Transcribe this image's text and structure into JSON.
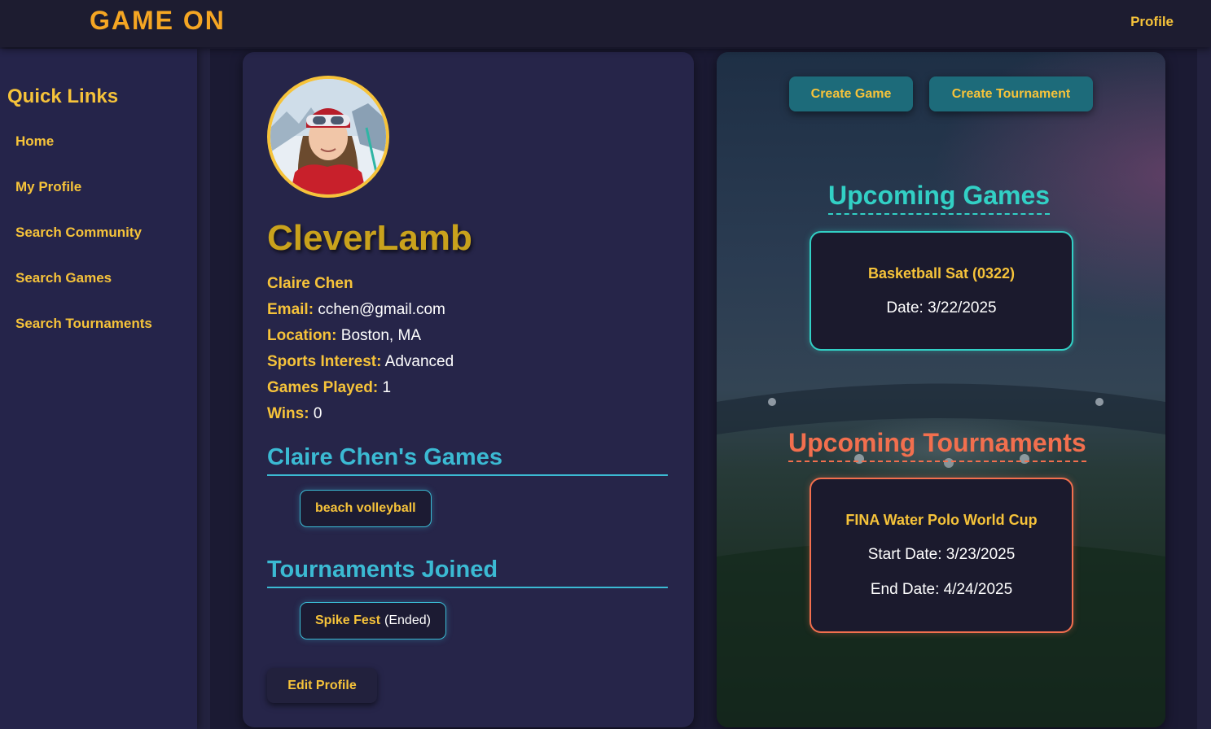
{
  "header": {
    "brand": "GAME ON",
    "profile_link": "Profile"
  },
  "sidebar": {
    "title": "Quick Links",
    "items": [
      "Home",
      "My Profile",
      "Search Community",
      "Search Games",
      "Search Tournaments"
    ]
  },
  "profile": {
    "username": "CleverLamb",
    "full_name": "Claire Chen",
    "fields": [
      {
        "label": "Email:",
        "value": "cchen@gmail.com"
      },
      {
        "label": "Location:",
        "value": "Boston, MA"
      },
      {
        "label": "Sports Interest:",
        "value": "Advanced"
      },
      {
        "label": "Games Played:",
        "value": "1"
      },
      {
        "label": "Wins:",
        "value": "0"
      }
    ],
    "games_title": "Claire Chen's Games",
    "games": [
      {
        "name": "beach volleyball"
      }
    ],
    "tournaments_title": "Tournaments Joined",
    "tournaments": [
      {
        "name": "Spike Fest",
        "status": "(Ended)"
      }
    ],
    "edit_label": "Edit Profile"
  },
  "actions": {
    "create_game": "Create Game",
    "create_tournament": "Create Tournament"
  },
  "upcoming_games": {
    "title": "Upcoming Games",
    "items": [
      {
        "name": "Basketball Sat (0322)",
        "date": "Date: 3/22/2025"
      }
    ]
  },
  "upcoming_tournaments": {
    "title": "Upcoming Tournaments",
    "items": [
      {
        "name": "FINA Water Polo World Cup",
        "start": "Start Date: 3/23/2025",
        "end": "End Date: 4/24/2025"
      }
    ]
  },
  "colors": {
    "accent_gold": "#f6c33a",
    "accent_cyan": "#3bbad3",
    "accent_teal": "#32d0c5",
    "accent_coral": "#f26f4e",
    "brand_orange": "#f5a623"
  }
}
